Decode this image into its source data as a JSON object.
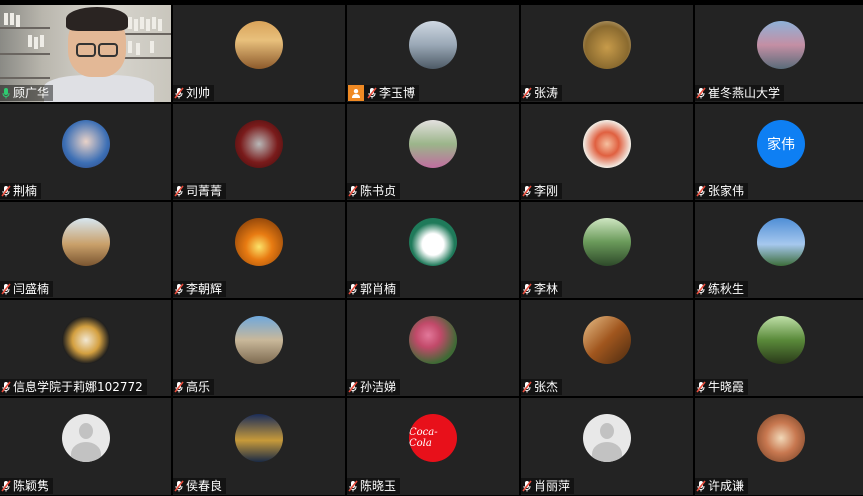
{
  "participants": [
    {
      "name": "顾广华",
      "type": "video",
      "speaking": true,
      "mic": "on"
    },
    {
      "name": "刘帅",
      "avatar_bg": "linear-gradient(180deg,#d9a35a 0%,#e8c07c 40%,#8d5a2b 100%)"
    },
    {
      "name": "李玉博",
      "host": true,
      "avatar_bg": "linear-gradient(180deg,#cfd8e2 0%,#9aa8b6 50%,#4d5a66 100%)"
    },
    {
      "name": "张涛",
      "avatar_bg": "radial-gradient(circle at 50% 55%,#c79b4a 0%,#8a6a2f 60%,#d9c7a6 100%)"
    },
    {
      "name": "崔冬燕山大学",
      "avatar_bg": "linear-gradient(180deg,#8fb2d8 0%,#c48fa4 50%,#5a6c7a 100%)"
    },
    {
      "name": "荆楠",
      "avatar_bg": "radial-gradient(circle at 50% 45%,#e9d2c8 0%,#3c6fb5 60%,#2a3f7a 100%)"
    },
    {
      "name": "司菁菁",
      "avatar_bg": "radial-gradient(circle at 50% 50%,#b8b8b8 0%,#7a1b1b 55%,#3a0a0a 100%)"
    },
    {
      "name": "陈书贞",
      "avatar_bg": "linear-gradient(180deg,#e3e1df 0%,#9bb58a 50%,#c06ea0 100%)"
    },
    {
      "name": "李刚",
      "avatar_bg": "radial-gradient(circle at 50% 50%,#f5c0a0 0%,#e06040 35%,#f2ede5 70%)"
    },
    {
      "name": "张家伟",
      "avatar_text": "家伟",
      "avatar_color": "#0e7ff3"
    },
    {
      "name": "闫盛楠",
      "avatar_bg": "linear-gradient(180deg,#d7e6f0 0%,#c9a06a 55%,#7a5530 100%)"
    },
    {
      "name": "李朝辉",
      "avatar_bg": "radial-gradient(circle at 50% 60%,#fbe36a 0%,#e87b12 35%,#6a2e06 100%)"
    },
    {
      "name": "郭肖楠",
      "avatar_bg": "radial-gradient(circle at 50% 55%,#ffffff 0%,#ffffff 30%,#1f7a5a 60%)"
    },
    {
      "name": "李林",
      "avatar_bg": "linear-gradient(180deg,#cfe6c2 0%,#6a9a5a 50%,#2e4a2a 100%)"
    },
    {
      "name": "练秋生",
      "avatar_bg": "linear-gradient(180deg,#4f8ed6 0%,#a6c8ee 55%,#3d6d3a 100%)"
    },
    {
      "name": "信息学院于莉娜102772",
      "avatar_bg": "radial-gradient(circle at 50% 50%,#f1e7d2 0%,#d4a040 40%,#1e1e1e 70%)"
    },
    {
      "name": "高乐",
      "avatar_bg": "linear-gradient(180deg,#6fa8dc 0%,#c9b89a 50%,#7d6a50 100%)"
    },
    {
      "name": "孙洁娣",
      "avatar_bg": "radial-gradient(circle at 40% 40%,#e2789a 0%,#c24a6a 30%,#3f6a35 70%)"
    },
    {
      "name": "张杰",
      "avatar_bg": "linear-gradient(135deg,#e8c089 0%,#a0561e 50%,#4a2a10 100%)"
    },
    {
      "name": "牛晓霞",
      "avatar_bg": "linear-gradient(180deg,#bfe0a8 0%,#5a8a3a 50%,#2a3a1a 100%)"
    },
    {
      "name": "陈颖隽",
      "avatar_default": true
    },
    {
      "name": "侯春良",
      "avatar_bg": "linear-gradient(180deg,#1b2d5a 0%,#c79a3a 55%,#1a2a45 100%)"
    },
    {
      "name": "陈晓玉",
      "avatar_text_logo": "Coca-Cola",
      "avatar_color": "#e8101a"
    },
    {
      "name": "肖丽萍",
      "avatar_default": true
    },
    {
      "name": "许成谦",
      "avatar_bg": "radial-gradient(circle at 50% 50%,#f1d8b8 0%,#c87850 45%,#6a3a20 100%)"
    }
  ],
  "colors": {
    "tile_bg": "#232323",
    "speaking_border": "#2ecc71",
    "mic_muted": "#e74c3c",
    "mic_on": "#2ecc71",
    "host_badge": "#f08a24"
  }
}
